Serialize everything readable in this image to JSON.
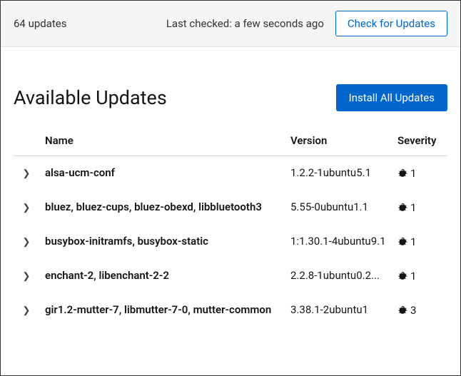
{
  "topbar": {
    "update_count": "64 updates",
    "last_checked": "Last checked: a few seconds ago",
    "check_button": "Check for Updates"
  },
  "header": {
    "title": "Available Updates",
    "install_button": "Install All Updates"
  },
  "table": {
    "headers": {
      "name": "Name",
      "version": "Version",
      "severity": "Severity"
    },
    "rows": [
      {
        "name": "alsa-ucm-conf",
        "version": "1.2.2-1ubuntu5.1",
        "severity": "1"
      },
      {
        "name": "bluez, bluez-cups, bluez-obexd, libbluetooth3",
        "version": "5.55-0ubuntu1.1",
        "severity": "1"
      },
      {
        "name": "busybox-initramfs, busybox-static",
        "version": "1:1.30.1-4ubuntu9.1",
        "severity": "1"
      },
      {
        "name": "enchant-2, libenchant-2-2",
        "version": "2.2.8-1ubuntu0.2...",
        "severity": "1"
      },
      {
        "name": "gir1.2-mutter-7, libmutter-7-0, mutter-common",
        "version": "3.38.1-2ubuntu1",
        "severity": "3"
      }
    ]
  }
}
